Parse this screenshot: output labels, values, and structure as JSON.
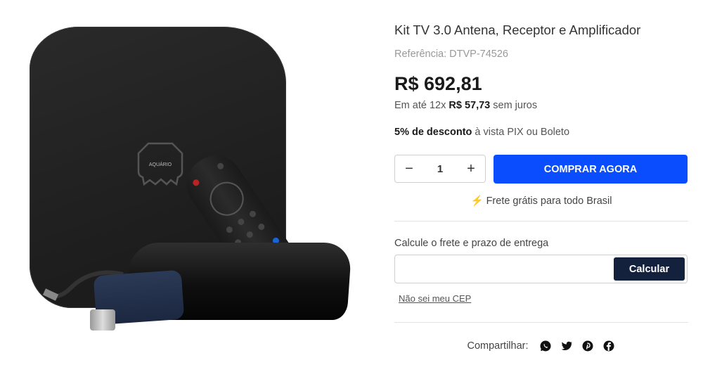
{
  "product": {
    "title": "Kit TV 3.0 Antena, Receptor e Amplificador",
    "reference": "Referência: DTVP-74526",
    "price": "R$ 692,81",
    "installment_prefix": "Em até 12x ",
    "installment_value": "R$ 57,73",
    "installment_suffix": " sem juros",
    "discount_bold": "5% de desconto",
    "discount_rest": " à vista PIX ou Boleto",
    "image_brand_text": "AQUÁRIO"
  },
  "purchase": {
    "quantity": "1",
    "minus_symbol": "−",
    "plus_symbol": "+",
    "buy_label": "COMPRAR AGORA",
    "free_shipping": "Frete grátis para todo Brasil"
  },
  "shipping_calc": {
    "label": "Calcule o frete e prazo de entrega",
    "input_placeholder": "",
    "button_label": "Calcular",
    "no_cep_link": "Não sei meu CEP"
  },
  "share": {
    "label": "Compartilhar:",
    "icons": [
      "whatsapp-icon",
      "twitter-icon",
      "pinterest-icon",
      "facebook-icon"
    ]
  },
  "colors": {
    "buy_button": "#0a4dff",
    "calc_button": "#14213d",
    "bolt": "#e07b00"
  }
}
